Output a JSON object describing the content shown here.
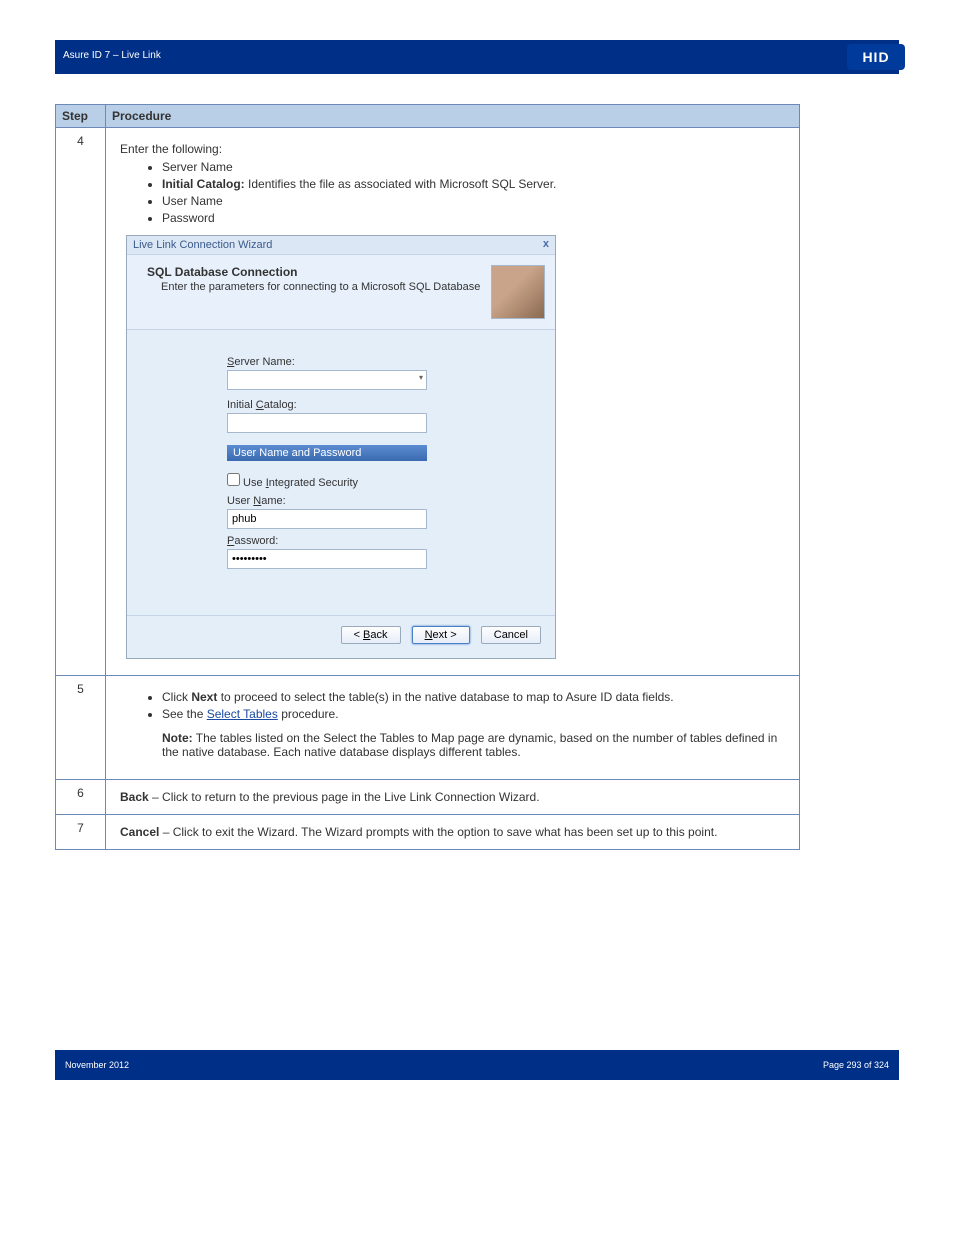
{
  "header": {
    "banner_caption": "Asure ID 7 – Live Link",
    "logo": "HID"
  },
  "table": {
    "col_step": "Step",
    "col_proc": "Procedure",
    "row4": {
      "num": "4",
      "intro": "Enter the following:",
      "b1": "Server Name",
      "b2": "Initial Catalog:",
      "b2_desc": " Identifies the file as associated with Microsoft SQL Server.",
      "b3": "User Name",
      "b4": "Password"
    },
    "wizard": {
      "title": "Live Link Connection Wizard",
      "head_title": "SQL Database Connection",
      "head_sub": "Enter the parameters for connecting to a Microsoft SQL Database",
      "close": "x",
      "lbl_server": "Server Name:",
      "lbl_catalog": "Initial Catalog:",
      "grp_title": "User Name and Password",
      "chk_integrated": "Use Integrated Security",
      "lbl_user": "User Name:",
      "val_user": "phub",
      "lbl_pass": "Password:",
      "val_pass": "•••••••••",
      "btn_back": "< Back",
      "btn_next": "Next >",
      "btn_cancel": "Cancel"
    },
    "row5": {
      "num": "5",
      "b1_pre": "Click ",
      "b1_btn": "Next",
      "b1_post": " to proceed to select the table(s) in the native database to map to Asure ID data fields.",
      "b2": "See the ",
      "b2_link": "Select Tables",
      "b2_post": " procedure.",
      "note_lbl": "Note:",
      "note_txt": " The tables listed on the Select the Tables to Map page are dynamic, based on the number of tables defined in the native database. Each native database displays different tables."
    },
    "row6": {
      "num": "6",
      "lbl": "Back",
      "txt": " – Click to return to the previous page in the Live Link Connection Wizard."
    },
    "row7": {
      "num": "7",
      "lbl": "Cancel",
      "txt": " – Click to exit the Wizard. The Wizard prompts with the option to save what has been set up to this point."
    }
  },
  "footer": {
    "left": "November 2012",
    "right": "Page 293 of 324"
  }
}
